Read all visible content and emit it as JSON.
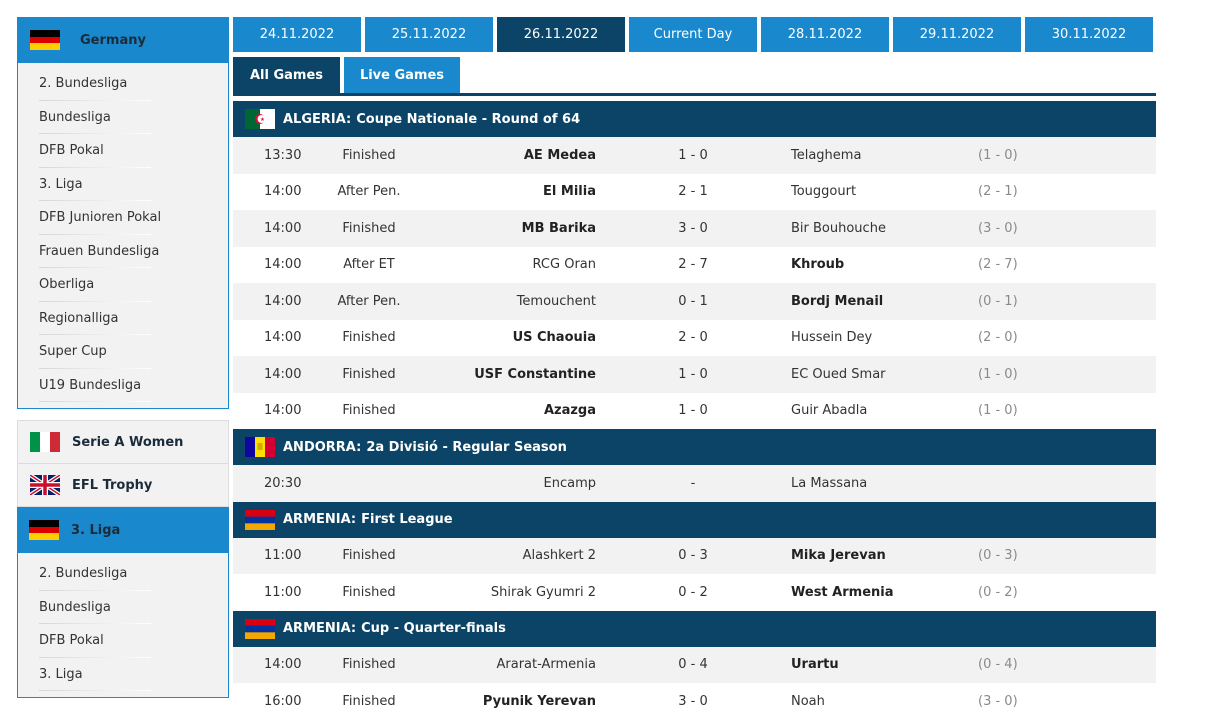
{
  "sidebar": {
    "germany": {
      "name": "Germany",
      "leagues": [
        "2. Bundesliga",
        "Bundesliga",
        "DFB Pokal",
        "3. Liga",
        "DFB Junioren Pokal",
        "Frauen Bundesliga",
        "Oberliga",
        "Regionalliga",
        "Super Cup",
        "U19 Bundesliga"
      ]
    },
    "serie_a_women": "Serie A Women",
    "efl_trophy": "EFL Trophy",
    "liga3": {
      "name": "3. Liga",
      "leagues": [
        "2. Bundesliga",
        "Bundesliga",
        "DFB Pokal",
        "3. Liga"
      ]
    }
  },
  "dates": [
    "24.11.2022",
    "25.11.2022",
    "26.11.2022",
    "Current Day",
    "28.11.2022",
    "29.11.2022",
    "30.11.2022"
  ],
  "filters": {
    "all": "All Games",
    "live": "Live Games"
  },
  "competitions": [
    {
      "country": "ALGERIA:",
      "name": "Coupe Nationale - Round of 64",
      "flag": "algeria",
      "matches": [
        {
          "time": "13:30",
          "status": "Finished",
          "home": "AE Medea",
          "score": "1 - 0",
          "away": "Telaghema",
          "ht": "(1 - 0)",
          "winner": "home"
        },
        {
          "time": "14:00",
          "status": "After Pen.",
          "home": "El Milia",
          "score": "2 - 1",
          "away": "Touggourt",
          "ht": "(2 - 1)",
          "winner": "home"
        },
        {
          "time": "14:00",
          "status": "Finished",
          "home": "MB Barika",
          "score": "3 - 0",
          "away": "Bir Bouhouche",
          "ht": "(3 - 0)",
          "winner": "home"
        },
        {
          "time": "14:00",
          "status": "After ET",
          "home": "RCG Oran",
          "score": "2 - 7",
          "away": "Khroub",
          "ht": "(2 - 7)",
          "winner": "away"
        },
        {
          "time": "14:00",
          "status": "After Pen.",
          "home": "Temouchent",
          "score": "0 - 1",
          "away": "Bordj Menail",
          "ht": "(0 - 1)",
          "winner": "away"
        },
        {
          "time": "14:00",
          "status": "Finished",
          "home": "US Chaouia",
          "score": "2 - 0",
          "away": "Hussein Dey",
          "ht": "(2 - 0)",
          "winner": "home"
        },
        {
          "time": "14:00",
          "status": "Finished",
          "home": "USF Constantine",
          "score": "1 - 0",
          "away": "EC Oued Smar",
          "ht": "(1 - 0)",
          "winner": "home"
        },
        {
          "time": "14:00",
          "status": "Finished",
          "home": "Azazga",
          "score": "1 - 0",
          "away": "Guir Abadla",
          "ht": "(1 - 0)",
          "winner": "home"
        }
      ]
    },
    {
      "country": "ANDORRA:",
      "name": "2a Divisió - Regular Season",
      "flag": "andorra",
      "matches": [
        {
          "time": "20:30",
          "status": "",
          "home": "Encamp",
          "score": "-",
          "away": "La Massana",
          "ht": "",
          "winner": ""
        }
      ]
    },
    {
      "country": "ARMENIA:",
      "name": "First League",
      "flag": "armenia",
      "matches": [
        {
          "time": "11:00",
          "status": "Finished",
          "home": "Alashkert 2",
          "score": "0 - 3",
          "away": "Mika Jerevan",
          "ht": "(0 - 3)",
          "winner": "away"
        },
        {
          "time": "11:00",
          "status": "Finished",
          "home": "Shirak Gyumri 2",
          "score": "0 - 2",
          "away": "West Armenia",
          "ht": "(0 - 2)",
          "winner": "away"
        }
      ]
    },
    {
      "country": "ARMENIA:",
      "name": "Cup - Quarter-finals",
      "flag": "armenia",
      "matches": [
        {
          "time": "14:00",
          "status": "Finished",
          "home": "Ararat-Armenia",
          "score": "0 - 4",
          "away": "Urartu",
          "ht": "(0 - 4)",
          "winner": "away"
        },
        {
          "time": "16:00",
          "status": "Finished",
          "home": "Pyunik Yerevan",
          "score": "3 - 0",
          "away": "Noah",
          "ht": "(3 - 0)",
          "winner": "home"
        }
      ]
    }
  ]
}
